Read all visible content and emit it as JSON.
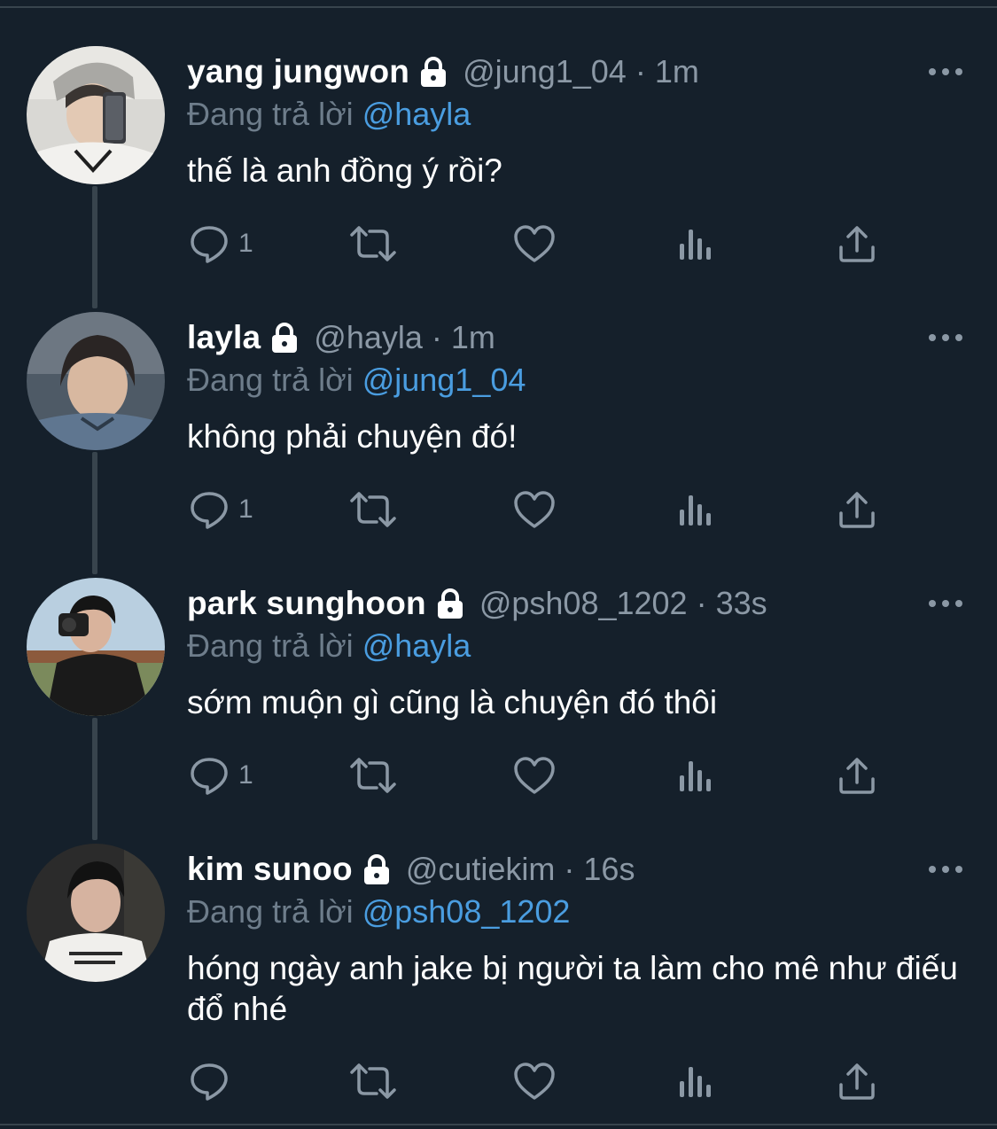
{
  "tweets": [
    {
      "name": "yang jungwon",
      "handle": "@jung1_04",
      "separator": "·",
      "time": "1m",
      "reply_prefix": "Đang trả lời",
      "reply_to": "@hayla",
      "text": "thế là anh đồng ý rồi?",
      "reply_count": "1",
      "icons": [
        "lock-icon",
        "more-icon",
        "reply-icon",
        "retweet-icon",
        "like-icon",
        "views-icon",
        "share-icon"
      ]
    },
    {
      "name": "layla",
      "handle": "@hayla",
      "separator": "·",
      "time": "1m",
      "reply_prefix": "Đang trả lời",
      "reply_to": "@jung1_04",
      "text": "không phải chuyện đó!",
      "reply_count": "1",
      "icons": [
        "lock-icon",
        "more-icon",
        "reply-icon",
        "retweet-icon",
        "like-icon",
        "views-icon",
        "share-icon"
      ]
    },
    {
      "name": "park sunghoon",
      "handle": "@psh08_1202",
      "separator": "·",
      "time": "33s",
      "reply_prefix": "Đang trả lời",
      "reply_to": "@hayla",
      "text": "sớm muộn gì cũng là chuyện đó thôi",
      "reply_count": "1",
      "icons": [
        "lock-icon",
        "more-icon",
        "reply-icon",
        "retweet-icon",
        "like-icon",
        "views-icon",
        "share-icon"
      ]
    },
    {
      "name": "kim sunoo",
      "handle": "@cutiekim",
      "separator": "·",
      "time": "16s",
      "reply_prefix": "Đang trả lời",
      "reply_to": "@psh08_1202",
      "text": "hóng ngày anh jake bị người ta làm cho mê như điếu đổ nhé",
      "reply_count": "",
      "icons": [
        "lock-icon",
        "more-icon",
        "reply-icon",
        "retweet-icon",
        "like-icon",
        "views-icon",
        "share-icon"
      ]
    }
  ],
  "colors": {
    "background": "#15202b",
    "primary_text": "#ffffff",
    "secondary_text": "#8b98a5",
    "mention": "#4a9de0",
    "divider": "#38444d"
  }
}
